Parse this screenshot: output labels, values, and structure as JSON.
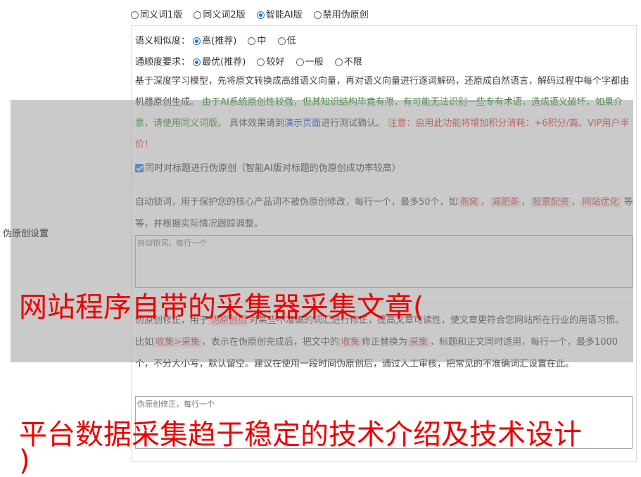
{
  "modes": [
    "同义词1版",
    "同义词2版",
    "智能AI版",
    "禁用伪原创"
  ],
  "selected_mode": 2,
  "similarity": {
    "label": "语义相似度：",
    "options": [
      "高(推荐)",
      "中",
      "低"
    ],
    "selected": 0
  },
  "fluency": {
    "label": "通顺度要求：",
    "options": [
      "最优(推荐)",
      "较好",
      "一般",
      "不限"
    ],
    "selected": 0
  },
  "desc": {
    "p1": "基于深度学习模型，先将原文转换成高维语义向量，再对语义向量进行逐词解码，还原成自然语言，解码过程中每个字都由机器原创生成。",
    "p2_green": "由于AI系统原创性较强，但其知识结构毕竟有限，有可能无法识别一些专有术语，造成语义破坏，如果介意，请使用同义词版。",
    "p3_pre": "具体效果请到",
    "p3_link": "演示页面",
    "p3_post": "进行测试确认。",
    "p4_red": "注意：启用此功能将增加积分消耗：+6积分/篇。VIP用户半价！"
  },
  "title_checkbox": "同时对标题进行伪原创（智能AI版对标题的伪原创成功率较高）",
  "side_label": "伪原创设置",
  "lock": {
    "pre": "自动锁词，用于保护您的核心产品词不被伪原创修改，每行一个，最多50个，如",
    "tags": [
      "燕窝",
      "减肥茶",
      "股票配资",
      "网站优化"
    ],
    "post": "等等，并根据实际情况跟踪调整。",
    "placeholder": "自动锁词，每行一个"
  },
  "fix": {
    "t1": "伪原创修正，用于",
    "tag1": "伪原创后",
    "t2": "对某些不准确的词汇进行修正，提高文章可读性，使文章更符合您网站所在行业的用语习惯。比如",
    "tag2": "收集>采集",
    "t3": "，表示在伪原创完成后，把文中的",
    "tag3": "收集",
    "t4": "修正替换为",
    "tag4": "采集",
    "t5": "，标题和正文同时适用，每行一个，最多1000个，不分大小写，默认留空。建议在使用一段时间伪原创后，通过人工审核，把常见的不准确词汇设置在此。",
    "placeholder": "伪原创修正，每行一个"
  },
  "overlay": {
    "line1": "网站程序自带的采集器采集文章(",
    "line2": "平台数据采集趋于稳定的技术介绍及技术设计",
    "line3": ")"
  },
  "colors": {
    "accent": "#1a73e8",
    "overlay_text": "#ee0000",
    "green": "#2e8b2e",
    "red": "#d33"
  }
}
